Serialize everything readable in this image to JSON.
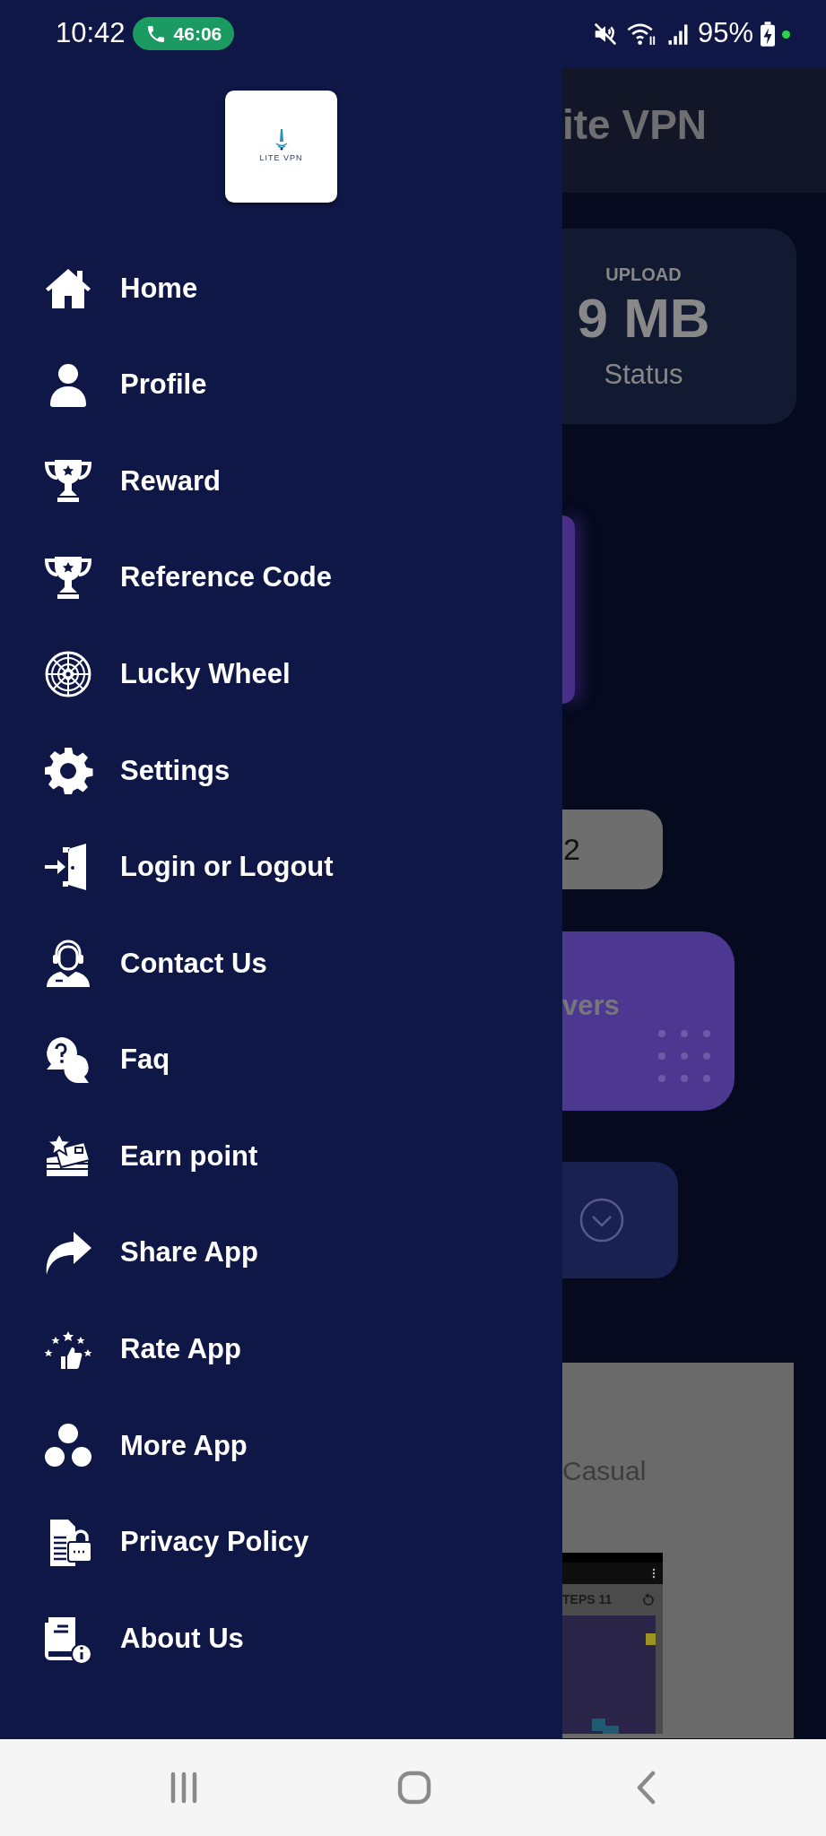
{
  "status_bar": {
    "time": "10:42",
    "call_timer": "46:06",
    "battery": "95%"
  },
  "drawer": {
    "logo_text": "LITE VPN",
    "items": [
      {
        "label": "Home",
        "kind": "home"
      },
      {
        "label": "Profile",
        "kind": "person"
      },
      {
        "label": "Reward",
        "kind": "trophy"
      },
      {
        "label": "Reference Code",
        "kind": "trophy"
      },
      {
        "label": "Lucky Wheel",
        "kind": "wheel"
      },
      {
        "label": "Settings",
        "kind": "gear"
      },
      {
        "label": "Login or Logout",
        "kind": "door"
      },
      {
        "label": "Contact Us",
        "kind": "headset"
      },
      {
        "label": "Faq",
        "kind": "chat"
      },
      {
        "label": "Earn point",
        "kind": "cards"
      },
      {
        "label": "Share App",
        "kind": "share"
      },
      {
        "label": "Rate App",
        "kind": "rate"
      },
      {
        "label": "More App",
        "kind": "dots"
      },
      {
        "label": "Privacy Policy",
        "kind": "lockdoc"
      },
      {
        "label": "About Us",
        "kind": "infobook"
      }
    ]
  },
  "background_app": {
    "title": "ite VPN",
    "upload_label": "UPLOAD",
    "upload_value": "9 MB",
    "status_label": "Status",
    "pill_text": "2",
    "servers_text": "vers",
    "ad_text": "Casual",
    "ad_game_text": "TEPS 11"
  }
}
